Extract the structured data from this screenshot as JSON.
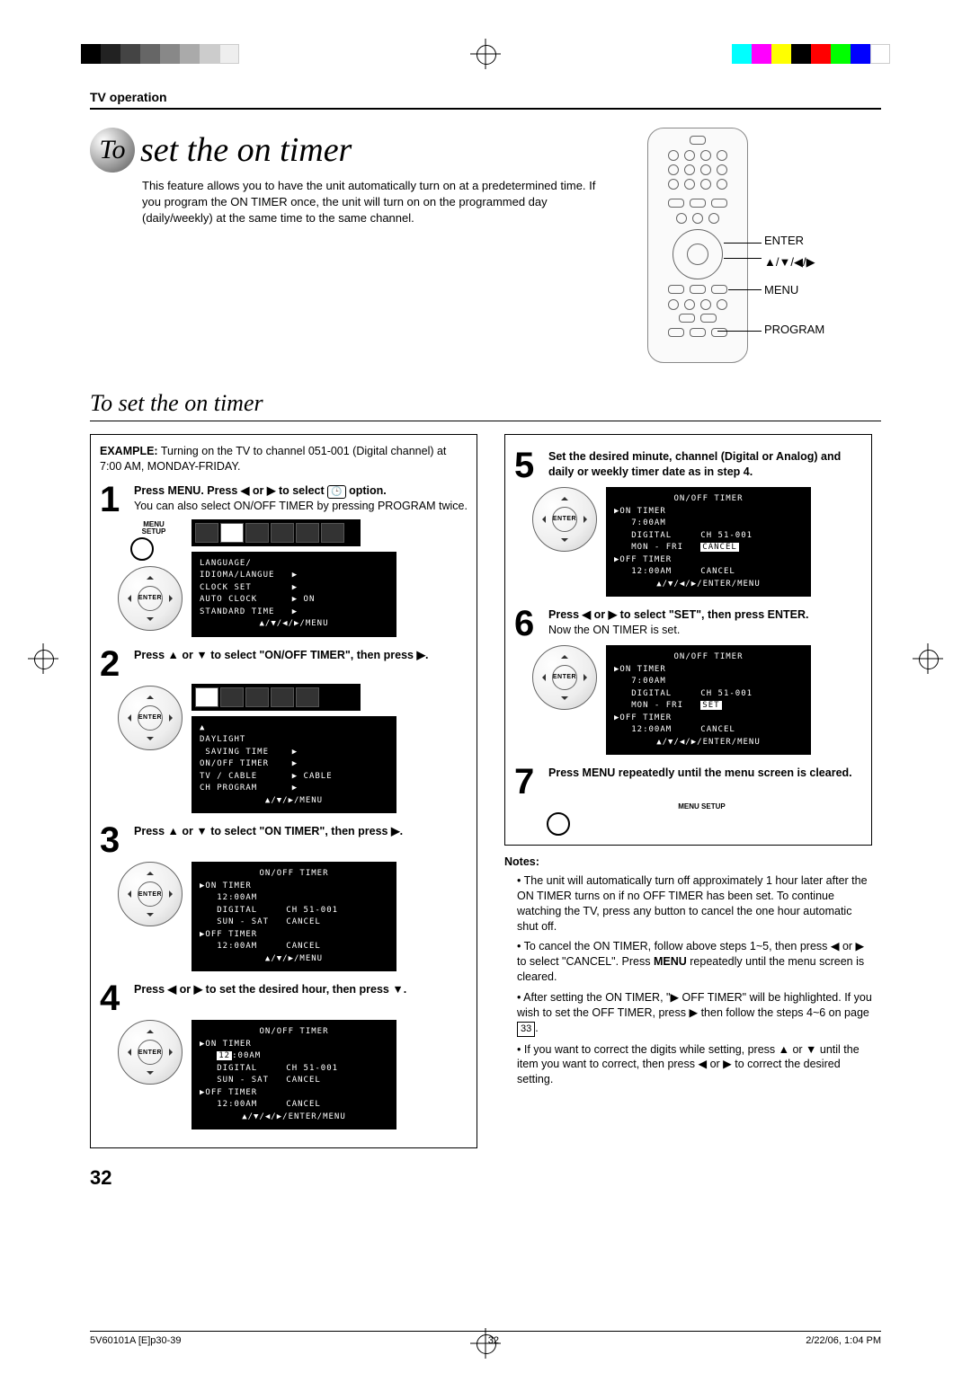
{
  "header": {
    "section": "TV operation"
  },
  "title": {
    "prefix": "To",
    "rest": " set the on timer"
  },
  "intro": "This feature allows you to have the unit automatically turn on at a predetermined time. If you program the ON TIMER once, the unit will turn on on the programmed day (daily/weekly) at the same time to the same channel.",
  "remote_labels": {
    "enter": "ENTER",
    "arrows": "▲/▼/◀/▶",
    "menu": "MENU",
    "program": "PROGRAM"
  },
  "subheading": "To set the on timer",
  "example": {
    "label": "EXAMPLE:",
    "text": "Turning on the TV to channel 051-001 (Digital channel) at 7:00 AM, MONDAY-FRIDAY."
  },
  "steps": {
    "s1": {
      "num": "1",
      "lead_a": "Press MENU. Press ◀ or ▶ to select ",
      "lead_b": " option.",
      "body": "You can also select ON/OFF TIMER by pressing PROGRAM twice.",
      "menu_label": "MENU\nSETUP"
    },
    "s2": {
      "num": "2",
      "lead": "Press ▲ or ▼ to select \"ON/OFF TIMER\", then press ▶."
    },
    "s3": {
      "num": "3",
      "lead": "Press ▲ or ▼ to select \"ON TIMER\", then press ▶."
    },
    "s4": {
      "num": "4",
      "lead": "Press ◀ or ▶ to set the desired hour, then press ▼."
    },
    "s5": {
      "num": "5",
      "lead": "Set the desired minute, channel (Digital or Analog) and daily or weekly timer date as in step 4."
    },
    "s6": {
      "num": "6",
      "lead": "Press ◀ or ▶ to select \"SET\", then press ENTER.",
      "body": "Now the ON TIMER is set."
    },
    "s7": {
      "num": "7",
      "lead": "Press MENU repeatedly until the menu screen is cleared.",
      "menu_label": "MENU\nSETUP"
    }
  },
  "osd": {
    "menu1": {
      "r1": "LANGUAGE/",
      "r2": "IDIOMA/LANGUE   ▶",
      "r3": "CLOCK SET       ▶",
      "r4": "AUTO CLOCK      ▶ ON",
      "r5": "STANDARD TIME   ▶",
      "foot": "▲/▼/◀/▶/MENU"
    },
    "menu2": {
      "r0": "▲",
      "r1": "DAYLIGHT",
      "r2": " SAVING TIME    ▶",
      "r3": "ON/OFF TIMER    ▶",
      "r4": "TV / CABLE      ▶ CABLE",
      "r5": "CH PROGRAM      ▶",
      "foot": "▲/▼/▶/MENU"
    },
    "timer3": {
      "title": "ON/OFF TIMER",
      "r1": "▶ON TIMER",
      "r2": "   12:00AM",
      "r3": "   DIGITAL     CH 51-001",
      "r4": "   SUN - SAT   CANCEL",
      "r5": "▶OFF TIMER",
      "r6": "   12:00AM     CANCEL",
      "foot": "▲/▼/▶/MENU"
    },
    "timer4": {
      "title": "ON/OFF TIMER",
      "r1": "▶ON TIMER",
      "r2_a": "   ",
      "r2_hl": "12",
      "r2_b": ":00AM",
      "r3": "   DIGITAL     CH 51-001",
      "r4": "   SUN - SAT   CANCEL",
      "r5": "▶OFF TIMER",
      "r6": "   12:00AM     CANCEL",
      "foot": "▲/▼/◀/▶/ENTER/MENU"
    },
    "timer5": {
      "title": "ON/OFF TIMER",
      "r1": "▶ON TIMER",
      "r2": "   7:00AM",
      "r3": "   DIGITAL     CH 51-001",
      "r4_a": "   MON - FRI   ",
      "r4_hl": "CANCEL",
      "r5": "▶OFF TIMER",
      "r6": "   12:00AM     CANCEL",
      "foot": "▲/▼/◀/▶/ENTER/MENU"
    },
    "timer6": {
      "title": "ON/OFF TIMER",
      "r1": "▶ON TIMER",
      "r2": "   7:00AM",
      "r3": "   DIGITAL     CH 51-001",
      "r4_a": "   MON - FRI   ",
      "r4_hl": "SET",
      "r5": "▶OFF TIMER",
      "r6": "   12:00AM     CANCEL",
      "foot": "▲/▼/◀/▶/ENTER/MENU"
    }
  },
  "notes": {
    "head": "Notes:",
    "n1": "The unit will automatically turn off approximately 1 hour later after the ON TIMER turns on if no OFF TIMER has been set. To continue watching the TV, press any button to cancel the one hour automatic shut off.",
    "n2_a": "To cancel the ON TIMER, follow above steps 1~5, then press ◀ or ▶ to select \"CANCEL\". Press ",
    "n2_b": "MENU",
    "n2_c": " repeatedly until the menu screen is cleared.",
    "n3_a": "After setting the ON TIMER, \"▶ OFF TIMER\" will be highlighted. If you wish to set the OFF TIMER, press ▶ then follow the steps 4~6 on page ",
    "n3_page": "33",
    "n3_b": ".",
    "n4": "If you want to correct the digits while setting, press ▲ or ▼ until the item you want to correct, then press ◀ or ▶ to correct the desired setting."
  },
  "page_number": "32",
  "footer": {
    "left": "5V60101A [E]p30-39",
    "center": "32",
    "right": "2/22/06, 1:04 PM"
  },
  "colorbar": [
    "#000",
    "#333",
    "#555",
    "#777",
    "#999",
    "#bbb",
    "#ddd",
    "#fff"
  ],
  "colorbar2": [
    "#0ff",
    "#f0f",
    "#ff0",
    "#000",
    "#f00",
    "#0f0",
    "#00f",
    "#fff"
  ]
}
